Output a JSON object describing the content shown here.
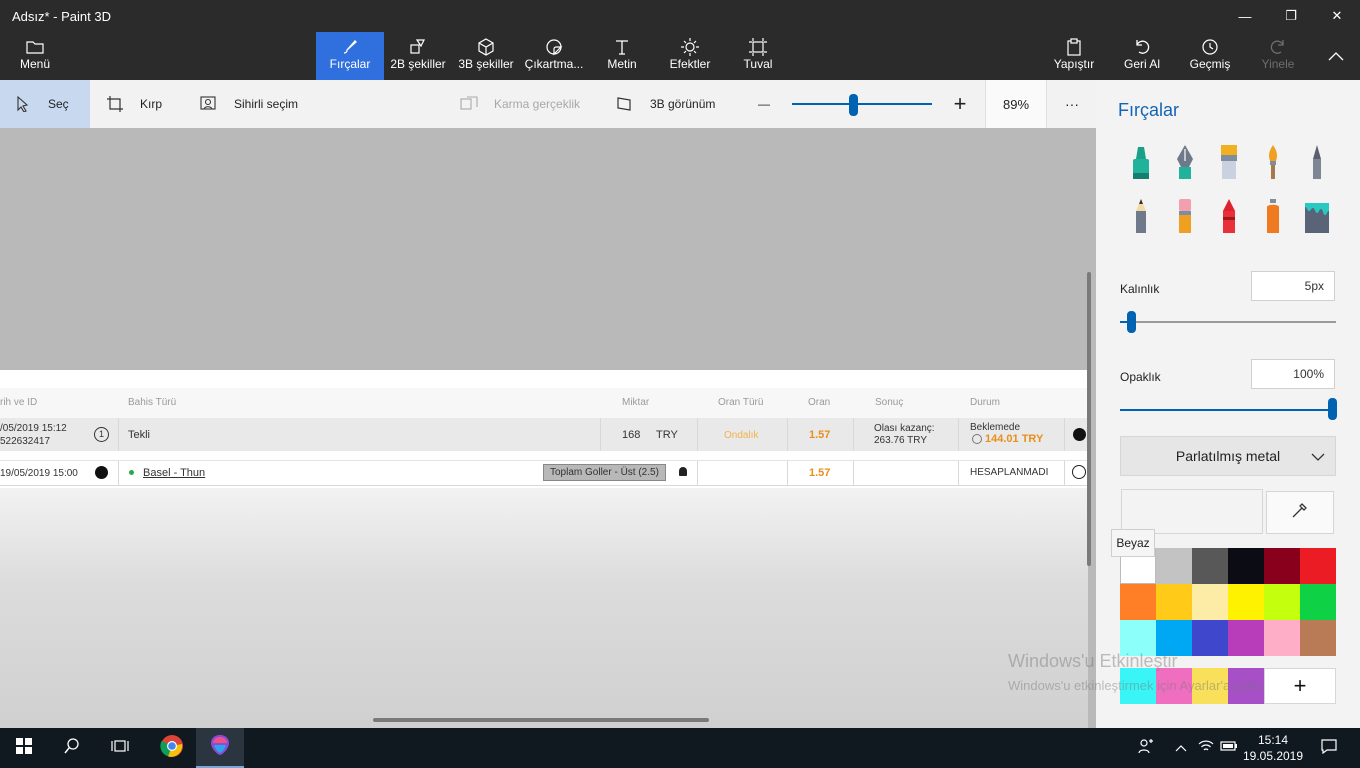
{
  "window": {
    "title": "Adsız* - Paint 3D",
    "minimize": "—",
    "maximize": "❐",
    "close": "✕"
  },
  "ribbon": {
    "menu": "Menü",
    "tools": [
      {
        "label": "Fırçalar",
        "icon": "brush-icon"
      },
      {
        "label": "2B şekiller",
        "icon": "2d-shapes-icon"
      },
      {
        "label": "3B şekiller",
        "icon": "3d-shapes-icon"
      },
      {
        "label": "Çıkartma...",
        "icon": "sticker-icon"
      },
      {
        "label": "Metin",
        "icon": "text-icon"
      },
      {
        "label": "Efektler",
        "icon": "effects-icon"
      },
      {
        "label": "Tuval",
        "icon": "canvas-icon"
      }
    ],
    "actions": [
      {
        "label": "Yapıştır",
        "icon": "paste-icon"
      },
      {
        "label": "Geri Al",
        "icon": "undo-icon"
      },
      {
        "label": "Geçmiş",
        "icon": "history-icon"
      },
      {
        "label": "Yinele",
        "icon": "redo-icon"
      }
    ]
  },
  "toolbar": {
    "select": "Seç",
    "crop": "Kırp",
    "magic_select": "Sihirli seçim",
    "mixed_reality": "Karma gerçeklik",
    "view_3d": "3B görünüm",
    "zoom_minus": "—",
    "zoom_plus": "+",
    "zoom_value": 0.89,
    "zoom_label": "89%",
    "more": "···"
  },
  "canvas_image": {
    "headers": [
      "rih ve ID",
      "Bahis Türü",
      "Miktar",
      "Oran Türü",
      "Oran",
      "Sonuç",
      "Durum"
    ],
    "row1": {
      "date": "/05/2019 15:12",
      "id": "522632417",
      "num": "1",
      "type": "Tekli",
      "amount": "168",
      "currency": "TRY",
      "odds_type": "Ondalık",
      "odds": "1.57",
      "result_label": "Olası kazanç:",
      "result_value": "263.76 TRY",
      "status": "Beklemede",
      "status_amount": "144.01 TRY"
    },
    "row2": {
      "date": "19/05/2019 15:00",
      "match": "Basel - Thun",
      "market": "Toplam Goller - Üst (2.5)",
      "odds": "1.57",
      "status": "HESAPLANMADI"
    }
  },
  "panel": {
    "title": "Fırçalar",
    "brushes": [
      "marker-icon",
      "calligraphy-pen-icon",
      "oil-brush-icon",
      "watercolor-icon",
      "pixel-pen-icon",
      "pencil-icon",
      "eraser-icon",
      "crayon-icon",
      "spray-can-icon",
      "fill-bucket-icon"
    ],
    "thickness_label": "Kalınlık",
    "thickness_value": "5px",
    "thickness_fraction": 0.05,
    "opacity_label": "Opaklık",
    "opacity_value": "100%",
    "opacity_fraction": 1.0,
    "finish": "Parlatılmış metal",
    "tooltip": "Beyaz",
    "colors": [
      "#ffffff",
      "#c3c3c3",
      "#585858",
      "#0c0c14",
      "#88001b",
      "#ec1c24",
      "#ff7f27",
      "#ffca18",
      "#fdeca6",
      "#fff200",
      "#c4ff0e",
      "#0ed145",
      "#8cfffb",
      "#00a8f3",
      "#3f48cc",
      "#b83dba",
      "#ffaec8",
      "#b97a56"
    ],
    "custom_colors": [
      "#39f5f5",
      "#f06ec0",
      "#f8e05a",
      "#a64fc6"
    ],
    "add_color": "+"
  },
  "watermark": {
    "line1": "Windows'u Etkinleştir",
    "line2": "Windows'u etkinleştirmek için Ayarlar'a gidin."
  },
  "taskbar": {
    "time": "15:14",
    "date": "19.05.2019"
  }
}
